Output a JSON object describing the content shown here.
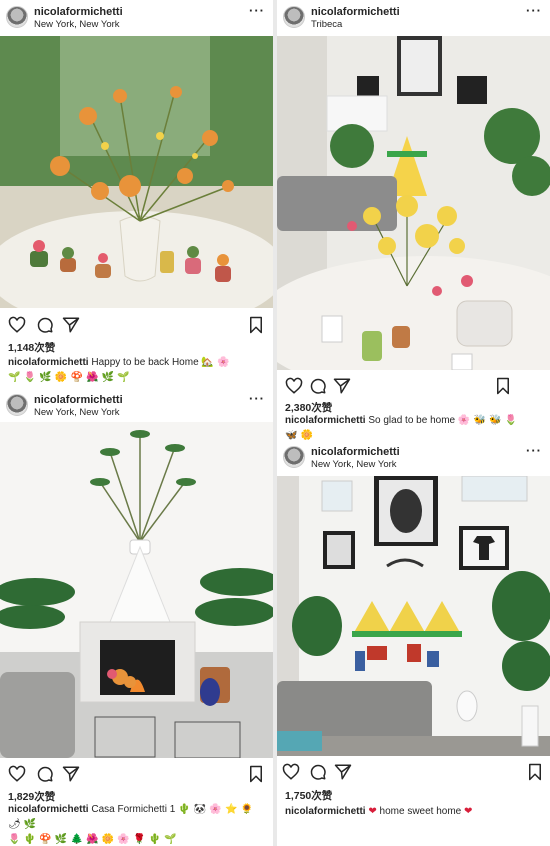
{
  "posts": [
    {
      "username": "nicolaformichetti",
      "location": "New York, New York",
      "likes": "1,148次赞",
      "caption": "Happy to be back Home",
      "caption_emoji": "🏡 🌸",
      "caption_emoji_line2": "🌱 🌷 🌿 🌼 🍄 🌺 🌿 🌱"
    },
    {
      "username": "nicolaformichetti",
      "location": "Tribeca",
      "likes": "2,380次赞",
      "caption": "So glad to be home",
      "caption_emoji": "🌸 🐝 🐝 🌷",
      "caption_emoji_line2": "🦋 🌼"
    },
    {
      "username": "nicolaformichetti",
      "location": "New York, New York",
      "likes": "1,829次赞",
      "caption": "Casa Formichetti 1",
      "caption_emoji": "🌵 🐼 🌸 ⭐ 🌻 🌶 🌿",
      "caption_emoji_line2": "🌷 🌵 🍄 🌿 🌲 🌺 🌼 🌸 🌹 🌵 🌱"
    },
    {
      "username": "nicolaformichetti",
      "location": "New York, New York",
      "likes": "1,750次赞",
      "caption": "home sweet home",
      "caption_emoji_pre": "❤",
      "caption_emoji": "❤"
    }
  ],
  "icons": {
    "like": "heart-icon",
    "comment": "comment-icon",
    "share": "send-icon",
    "save": "bookmark-icon",
    "more": "more-options-icon"
  },
  "more_glyph": "···"
}
